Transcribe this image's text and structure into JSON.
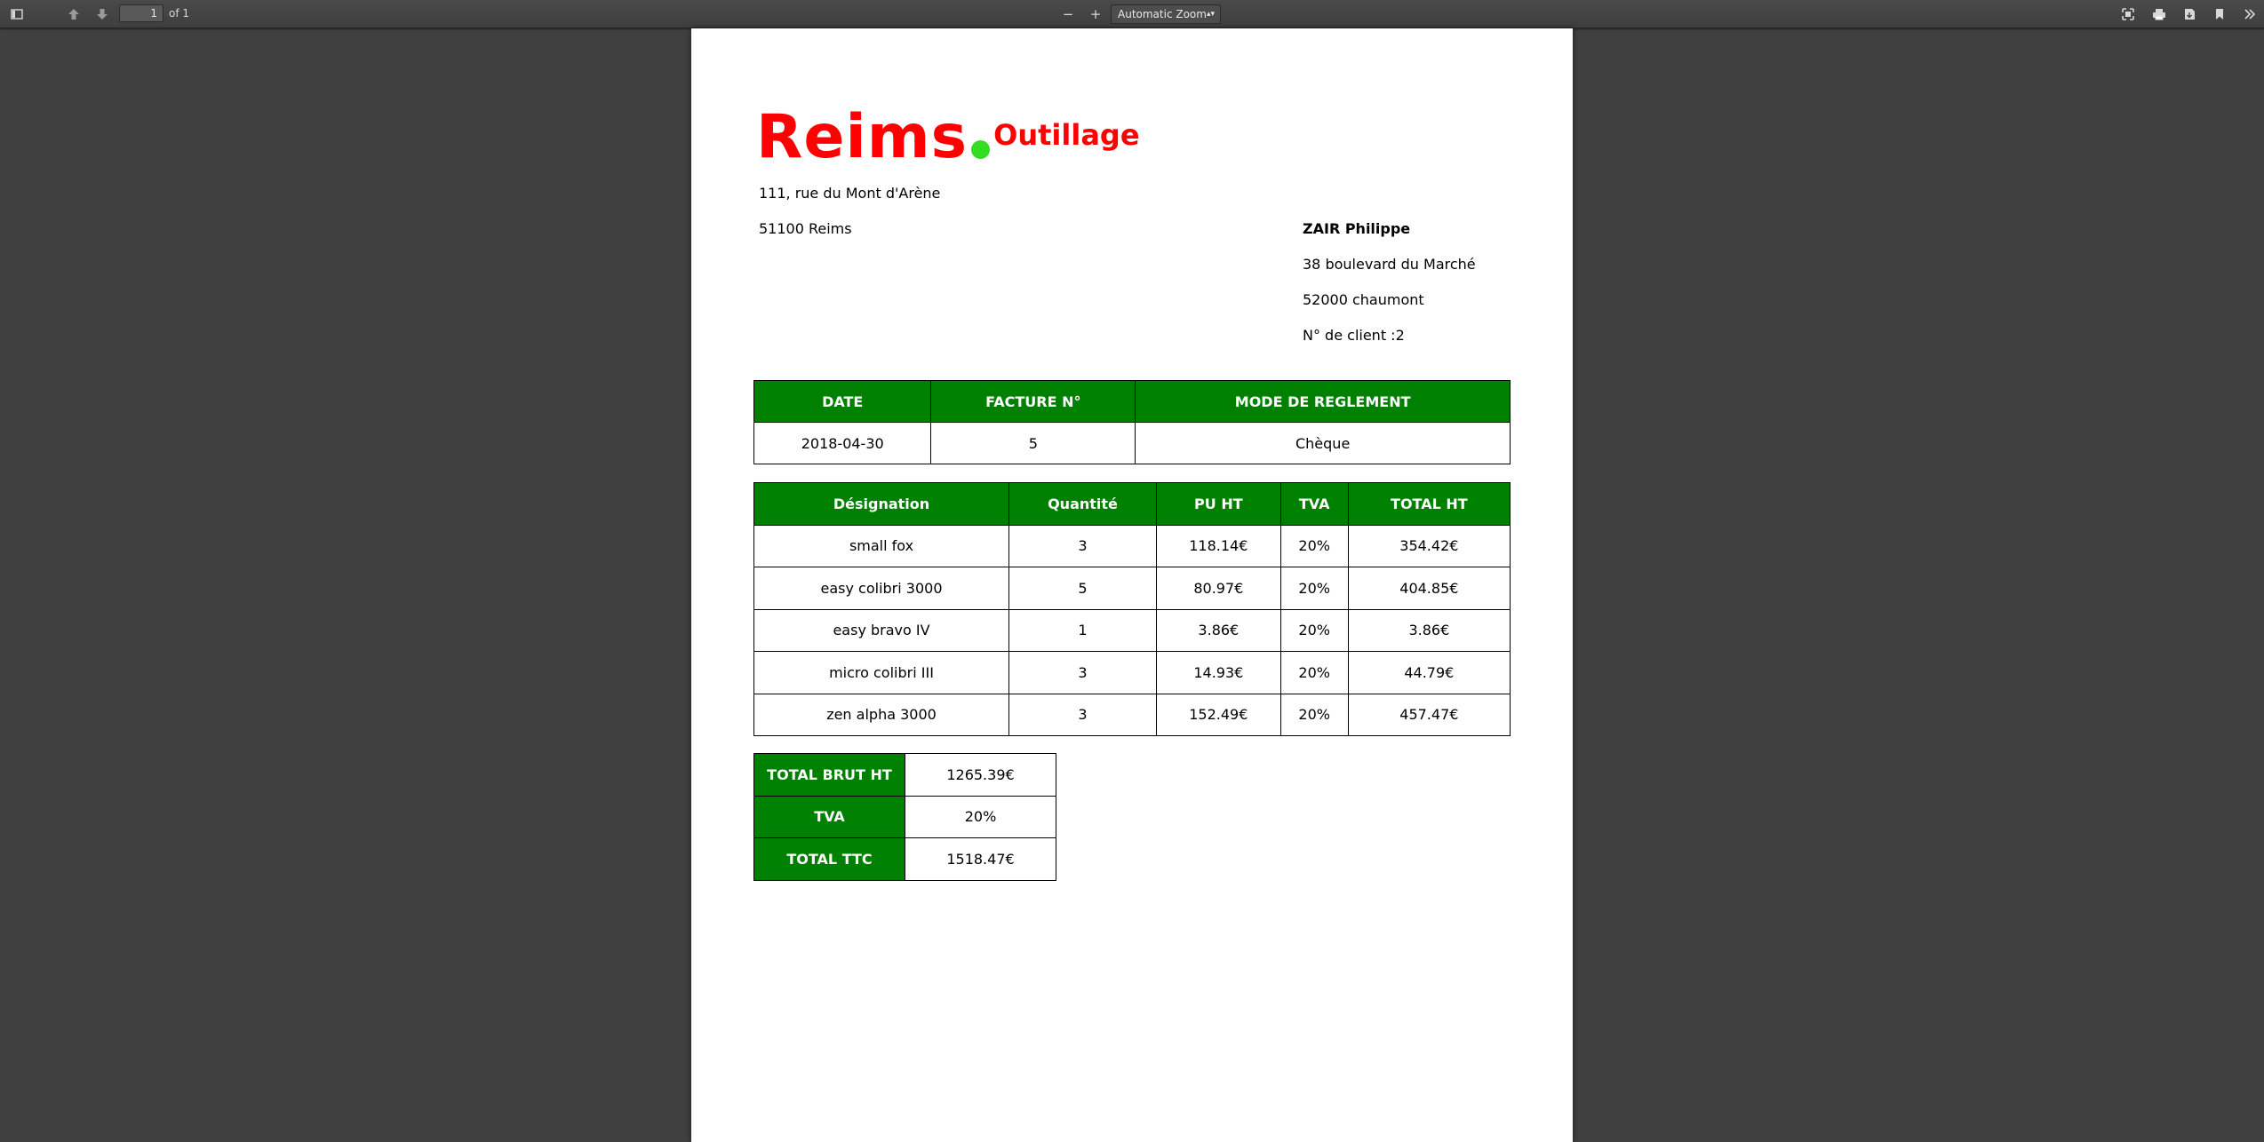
{
  "viewer": {
    "page_number": "1",
    "page_of": "of 1",
    "zoom": "Automatic Zoom",
    "zoom_out": "−",
    "zoom_in": "+"
  },
  "company": {
    "name_main": "Reims",
    "name_sub": "Outillage",
    "address_line1": "111, rue du Mont d'Arène",
    "address_line2": "51100 Reims"
  },
  "client": {
    "name": "ZAIR Philippe",
    "street": "38 boulevard du Marché",
    "city": "52000 chaumont",
    "number": "N° de client :2"
  },
  "invoice": {
    "headers": [
      "DATE",
      "FACTURE N°",
      "MODE DE REGLEMENT"
    ],
    "values": [
      "2018-04-30",
      "5",
      "Chèque"
    ]
  },
  "items": {
    "headers": [
      "Désignation",
      "Quantité",
      "PU HT",
      "TVA",
      "TOTAL HT"
    ],
    "rows": [
      [
        "small fox",
        "3",
        "118.14€",
        "20%",
        "354.42€"
      ],
      [
        "easy colibri 3000",
        "5",
        "80.97€",
        "20%",
        "404.85€"
      ],
      [
        "easy bravo IV",
        "1",
        "3.86€",
        "20%",
        "3.86€"
      ],
      [
        "micro colibri III",
        "3",
        "14.93€",
        "20%",
        "44.79€"
      ],
      [
        "zen alpha 3000",
        "3",
        "152.49€",
        "20%",
        "457.47€"
      ]
    ]
  },
  "totals": [
    {
      "label": "TOTAL BRUT HT",
      "value": "1265.39€"
    },
    {
      "label": "TVA",
      "value": "20%"
    },
    {
      "label": "TOTAL TTC",
      "value": "1518.47€"
    }
  ],
  "colors": {
    "brand_red": "#ff0000",
    "brand_dot": "#33dd22",
    "header_green": "#008000",
    "viewer_bg": "#404040"
  },
  "icons": [
    "sidebar-toggle-icon",
    "previous-page-icon",
    "next-page-icon",
    "presentation-mode-icon",
    "print-icon",
    "download-icon",
    "bookmark-icon",
    "tools-icon"
  ]
}
